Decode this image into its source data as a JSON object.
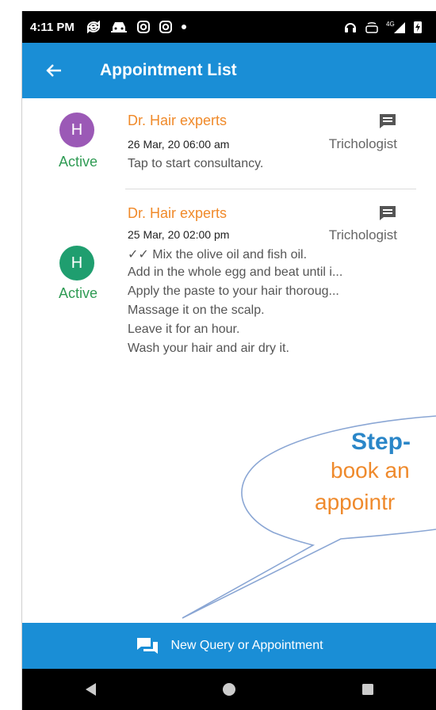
{
  "status_bar": {
    "time": "4:11 PM",
    "left_icons": [
      "sync-icon",
      "car-icon",
      "instagram-icon",
      "instagram-icon",
      "dot-icon"
    ],
    "right_icons": [
      "headset-icon",
      "volte-icon",
      "4g-signal-icon",
      "battery-charging-icon"
    ]
  },
  "app_bar": {
    "title": "Appointment List",
    "back_icon": "arrow-left-icon",
    "color": "#1a8ed6"
  },
  "appointments": [
    {
      "avatar_letter": "H",
      "avatar_color": "#9b59b6",
      "status": "Active",
      "doctor": "Dr. Hair experts",
      "datetime": "26 Mar, 20 06:00 am",
      "specialty": "Trichologist",
      "messages": [
        "Tap to start consultancy."
      ],
      "chat_icon": "chat-icon"
    },
    {
      "avatar_letter": "H",
      "avatar_color": "#1f9e6f",
      "status": "Active",
      "doctor": "Dr. Hair experts",
      "datetime": "25 Mar, 20 02:00 pm",
      "specialty": "Trichologist",
      "messages": [
        "✓✓ Mix the olive oil and fish oil.",
        "Add in the whole egg and beat until i...",
        "Apply the paste to your hair thoroug...",
        "Massage it on the scalp.",
        "Leave it for an hour.",
        "Wash your hair and air dry it."
      ],
      "chat_icon": "chat-icon"
    }
  ],
  "callout": {
    "step": "Step-",
    "line1": "book an",
    "line2": "appointr"
  },
  "bottom_button": {
    "label": "New Query or Appointment",
    "icon": "forum-icon"
  },
  "nav_bar": {
    "keys": [
      "back-triangle-icon",
      "home-circle-icon",
      "recents-square-icon"
    ]
  }
}
